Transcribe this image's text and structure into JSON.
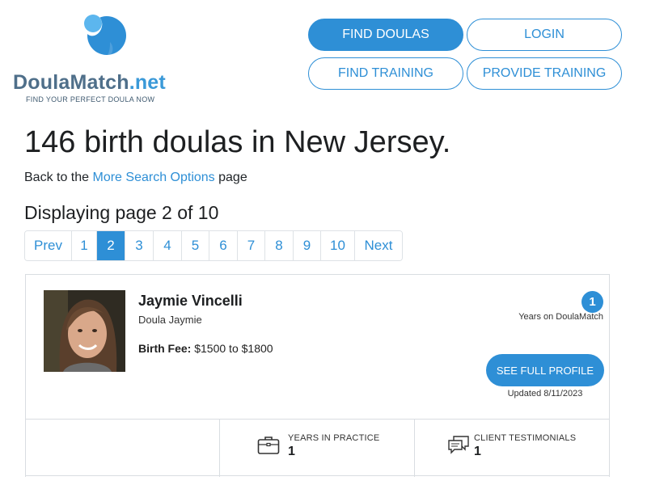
{
  "brand": {
    "name_part1": "Doula",
    "name_part2": "Match",
    "name_part3": ".net",
    "tagline": "FIND YOUR PERFECT DOULA NOW",
    "colors": {
      "primary": "#2e8fd6",
      "logo_light": "#5cb6ee",
      "text_dark": "#4f6f8a"
    }
  },
  "nav": {
    "find_doulas": "FIND DOULAS",
    "login": "LOGIN",
    "find_training": "FIND TRAINING",
    "provide_training": "PROVIDE TRAINING"
  },
  "heading": {
    "title": "146 birth doulas in New Jersey.",
    "back_prefix": "Back to the ",
    "back_link": "More Search Options",
    "back_suffix": " page",
    "page_indicator": "Displaying page 2 of 10"
  },
  "pagination": {
    "prev": "Prev",
    "pages": [
      "1",
      "2",
      "3",
      "4",
      "5",
      "6",
      "7",
      "8",
      "9",
      "10"
    ],
    "current": "2",
    "next": "Next"
  },
  "doula": {
    "name": "Jaymie Vincelli",
    "business": "Doula Jaymie",
    "fee_label": "Birth Fee:",
    "fee_value": " $1500 to $1800",
    "years_on_site": "1",
    "years_on_site_label": "Years on DoulaMatch",
    "profile_button": "SEE FULL PROFILE",
    "updated": "Updated 8/11/2023",
    "stats": {
      "years_in_practice_label": "YEARS IN PRACTICE",
      "years_in_practice": "1",
      "testimonials_label": "CLIENT TESTIMONIALS",
      "testimonials": "1"
    }
  },
  "icons": {
    "logo": "water-drop-logo-icon",
    "years_in_practice": "briefcase-icon",
    "testimonials": "chat-bubbles-icon"
  }
}
